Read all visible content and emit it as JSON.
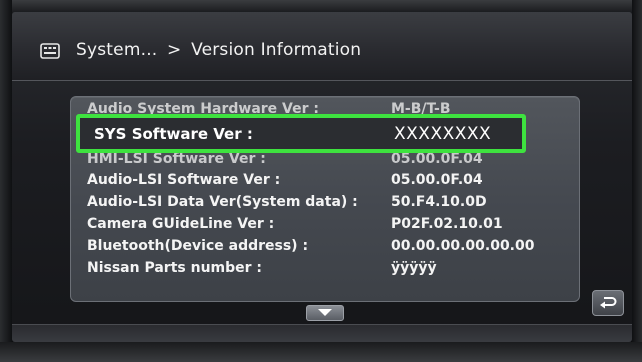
{
  "header": {
    "icon": "list-screen-icon",
    "breadcrumb_parent": "System...",
    "breadcrumb_separator": ">",
    "title": "Version Information"
  },
  "highlighted": {
    "label": "SYS Software Ver :",
    "value": "XXXXXXXX",
    "highlight_color": "#3ee23f"
  },
  "rows": [
    {
      "label": "Audio System Hardware Ver :",
      "value": "M-B/T-B"
    },
    {
      "label": "HMI-LSI Software Ver :",
      "value": "05.00.0F.04"
    },
    {
      "label": "Audio-LSI Software Ver :",
      "value": "05.00.0F.04"
    },
    {
      "label": "Audio-LSI Data Ver(System data) :",
      "value": "50.F4.10.0D"
    },
    {
      "label": "Camera GUideLine Ver :",
      "value": "P02F.02.10.01"
    },
    {
      "label": "Bluetooth(Device address) :",
      "value": "00.00.00.00.00.00"
    },
    {
      "label": "Nissan Parts number :",
      "value": "ÿÿÿÿÿ"
    }
  ],
  "controls": {
    "scroll_down_icon": "chevron-down-icon",
    "back_icon": "return-arrow-icon"
  }
}
